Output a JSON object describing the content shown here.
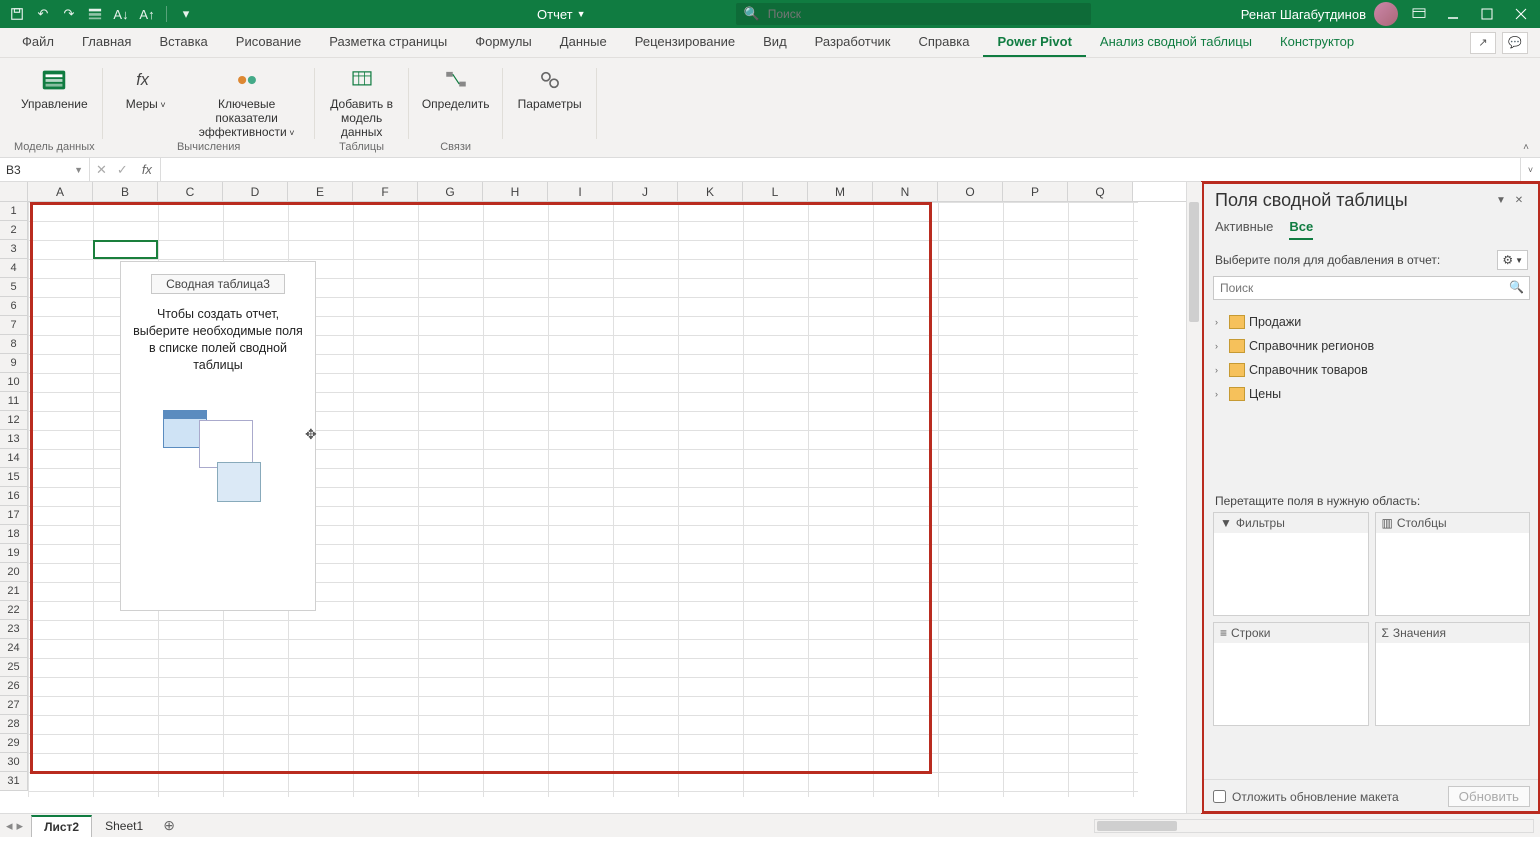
{
  "titlebar": {
    "docTitle": "Отчет",
    "searchPlaceholder": "Поиск",
    "userName": "Ренат Шагабутдинов"
  },
  "ribbonTabs": [
    "Файл",
    "Главная",
    "Вставка",
    "Рисование",
    "Разметка страницы",
    "Формулы",
    "Данные",
    "Рецензирование",
    "Вид",
    "Разработчик",
    "Справка",
    "Power Pivot",
    "Анализ сводной таблицы",
    "Конструктор"
  ],
  "ribbonActive": "Power Pivot",
  "ribbon": {
    "groups": [
      {
        "label": "Модель данных",
        "items": [
          {
            "name": "manage",
            "label": "Управление"
          }
        ]
      },
      {
        "label": "Вычисления",
        "items": [
          {
            "name": "measures",
            "label": "Меры"
          },
          {
            "name": "kpi",
            "label": "Ключевые показатели\nэффективности"
          }
        ]
      },
      {
        "label": "Таблицы",
        "items": [
          {
            "name": "add-to-model",
            "label": "Добавить в\nмодель данных"
          }
        ]
      },
      {
        "label": "Связи",
        "items": [
          {
            "name": "detect",
            "label": "Определить"
          }
        ]
      },
      {
        "label": "",
        "items": [
          {
            "name": "params",
            "label": "Параметры"
          }
        ]
      }
    ]
  },
  "nameBox": "B3",
  "columns": [
    "A",
    "B",
    "C",
    "D",
    "E",
    "F",
    "G",
    "H",
    "I",
    "J",
    "K",
    "L",
    "M",
    "N",
    "O",
    "P",
    "Q"
  ],
  "rowCount": 31,
  "pivotPlaceholder": {
    "title": "Сводная таблица3",
    "help": "Чтобы создать отчет, выберите необходимые поля в списке полей сводной таблицы"
  },
  "sheets": {
    "active": "Лист2",
    "list": [
      "Лист2",
      "Sheet1"
    ]
  },
  "panel": {
    "title": "Поля сводной таблицы",
    "tabs": [
      "Активные",
      "Все"
    ],
    "activeTab": "Все",
    "subtitle": "Выберите поля для добавления в отчет:",
    "searchPlaceholder": "Поиск",
    "tables": [
      "Продажи",
      "Справочник регионов",
      "Справочник товаров",
      "Цены"
    ],
    "dropLabel": "Перетащите поля в нужную область:",
    "zones": {
      "filters": "Фильтры",
      "columns": "Столбцы",
      "rows": "Строки",
      "values": "Значения"
    },
    "deferLabel": "Отложить обновление макета",
    "updateBtn": "Обновить"
  }
}
